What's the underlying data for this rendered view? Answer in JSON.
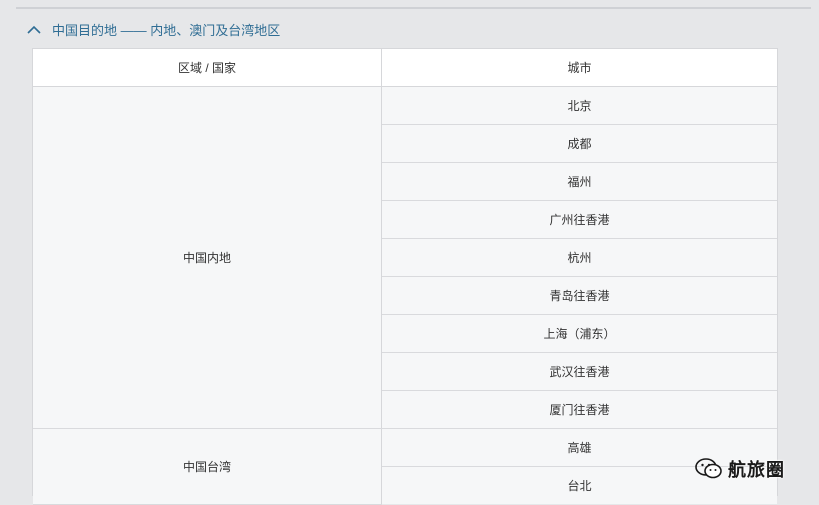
{
  "section": {
    "title": "中国目的地 —— 内地、澳门及台湾地区",
    "expanded": true,
    "accent_color": "#2f6d94",
    "icon": "chevron-up-icon"
  },
  "table": {
    "headers": {
      "region": "区域 / 国家",
      "city": "城市"
    },
    "groups": [
      {
        "region": "中国内地",
        "cities": [
          "北京",
          "成都",
          "福州",
          "广州往香港",
          "杭州",
          "青岛往香港",
          "上海（浦东）",
          "武汉往香港",
          "厦门往香港"
        ]
      },
      {
        "region": "中国台湾",
        "cities": [
          "高雄",
          "台北"
        ]
      }
    ]
  },
  "watermark": {
    "text": "航旅圈",
    "icon": "wechat-icon"
  }
}
